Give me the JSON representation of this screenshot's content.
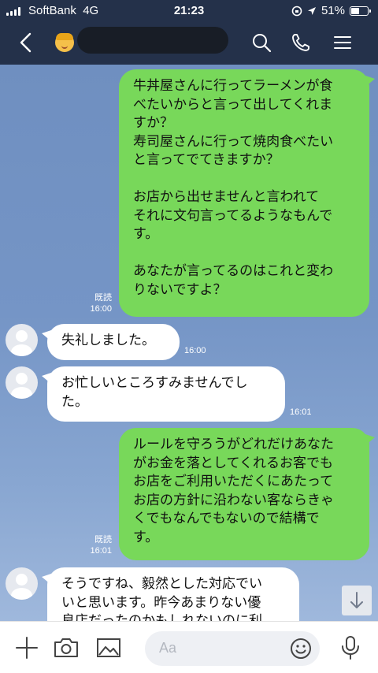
{
  "status_bar": {
    "carrier": "SoftBank",
    "network": "4G",
    "time": "21:23",
    "battery": "51%",
    "battery_level": 0.51
  },
  "header": {
    "contact_avatar": "person-emoji",
    "icons": {
      "back": "chevron-left-icon",
      "search": "search-icon",
      "call": "phone-icon",
      "menu": "menu-icon"
    }
  },
  "messages": [
    {
      "side": "mine",
      "text": "牛丼屋さんに行ってラーメンが食\nべたいからと言って出してくれま\nすか？\n寿司屋さんに行って焼肉食べたい\nと言ってでてきますか？\n\nお店から出せませんと言われて\nそれに文句言ってるようなもんで\nす。\n\nあなたが言ってるのはこれと変わ\nりないですよ？",
      "read": "既読",
      "time": "16:00"
    },
    {
      "side": "theirs",
      "text": "失礼しました。",
      "time": "16:00"
    },
    {
      "side": "theirs",
      "text": "お忙しいところすみませんでし\nた。",
      "time": "16:01"
    },
    {
      "side": "mine",
      "text": "ルールを守ろうがどれだけあなた\nがお金を落としてくれるお客でも\nお店をご利用いただくにあたって\nお店の方針に沿わない客ならきゃ\nくでもなんでもないので結構で\nす。",
      "read": "既読",
      "time": "16:01"
    },
    {
      "side": "theirs",
      "text": "そうですね、毅然とした対応でい\nいと思います。昨今あまりない優\n良店だったのかもしれないのに利"
    }
  ],
  "input_bar": {
    "placeholder": "Aa",
    "icons": {
      "add": "plus-icon",
      "camera": "camera-icon",
      "image": "image-icon",
      "emoji": "emoji-icon",
      "mic": "microphone-icon"
    }
  },
  "colors": {
    "header_bg": "#24314a",
    "my_bubble": "#78d85a",
    "their_bubble": "#ffffff",
    "chat_bg": "#7493c0"
  }
}
